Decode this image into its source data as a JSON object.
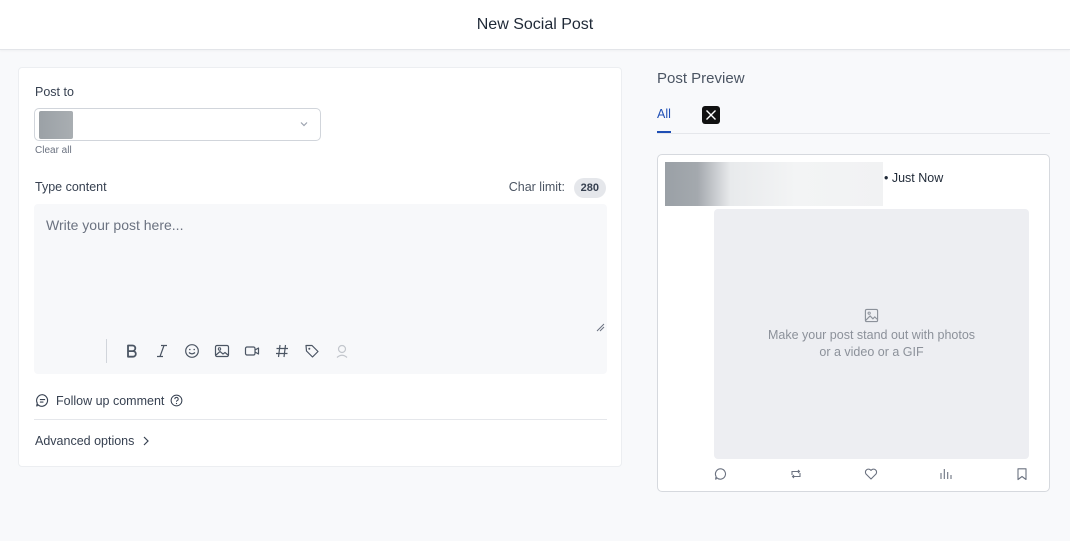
{
  "header": {
    "title": "New Social Post"
  },
  "composer": {
    "post_to_label": "Post to",
    "clear_all": "Clear all",
    "type_content_label": "Type content",
    "char_limit_label": "Char limit:",
    "char_limit_value": "280",
    "placeholder": "Write your post here...",
    "toolbar": [
      "bold-icon",
      "italic-icon",
      "emoji-icon",
      "image-icon",
      "video-icon",
      "hashtag-icon",
      "tag-icon",
      "location-icon"
    ],
    "follow_up": "Follow up comment",
    "advanced": "Advanced options"
  },
  "preview": {
    "title": "Post Preview",
    "tabs": {
      "all": "All",
      "x_icon": "x-logo-icon"
    },
    "timestamp": "• Just Now",
    "media_line1": "Make your post stand out with photos",
    "media_line2": "or a video or a GIF",
    "actions": [
      "reply-icon",
      "repost-icon",
      "like-icon",
      "views-icon",
      "bookmark-icon"
    ]
  },
  "colors": {
    "accent": "#1f4fb5",
    "background": "#f8f9fb"
  }
}
